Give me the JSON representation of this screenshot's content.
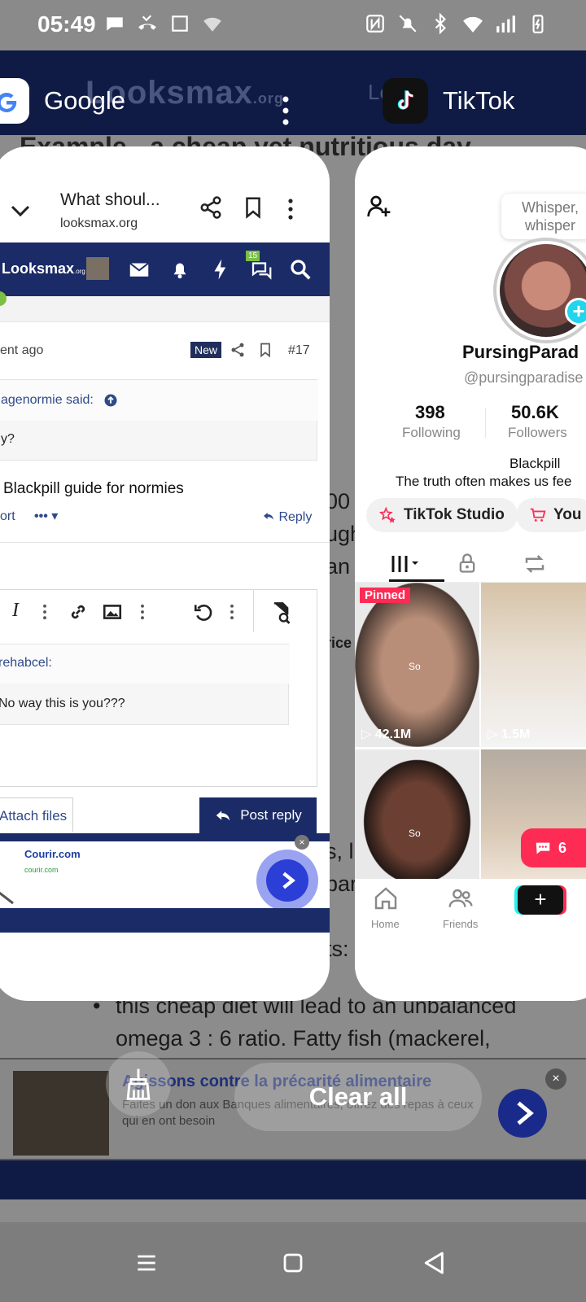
{
  "status_bar": {
    "time": "05:49",
    "icons_left": [
      "chat-icon",
      "missed-call-icon",
      "screen-icon",
      "wifi-calling-icon"
    ],
    "icons_right": [
      "nfc-icon",
      "mute-icon",
      "bluetooth-icon",
      "wifi-icon",
      "signal-icon",
      "battery-icon"
    ]
  },
  "background_page": {
    "site_logo": "Looksmax",
    "site_logo_suffix": ".org",
    "login_text": "Lo",
    "heading_text": "Example - a cheap yet nutritious day",
    "fragments": [
      "00",
      "ugh",
      "an :",
      "rice",
      "s, l",
      "bar",
      "ts:"
    ],
    "bullet_line_1": "this cheap diet will lead to an unbalanced",
    "bullet_line_2": "omega 3 : 6 ratio. Fatty fish (mackerel,",
    "ad_title": "Agissons contre la précarité alimentaire",
    "ad_desc": "Faites un don aux Banques alimentaires, offrez des repas à ceux qui en ont besoin",
    "ad_close": "×"
  },
  "recents": {
    "left_app": {
      "name": "Google",
      "menu_icon": "more-vert-icon"
    },
    "right_app": {
      "name": "TikTok"
    }
  },
  "browser_card": {
    "page_title": "What shoul...",
    "url": "looksmax.org",
    "nav_logo": "Looksmax",
    "nav_logo_suffix": ".org",
    "notif_badge": "15",
    "post_time": "ent ago",
    "badge_new": "New",
    "post_number": "#17",
    "quote_author": "agenormie said:",
    "quote_text": "y?",
    "post_text": "Blackpill guide for normies",
    "report_label": "ort",
    "more_label": "•••",
    "reply_label": "Reply",
    "editor_quote_author": "rehabcel:",
    "editor_quote_text": "No way this is you???",
    "attach_label": "Attach files",
    "post_reply_label": "Post reply",
    "ad_name": "Courir.com",
    "ad_url": "courir.com"
  },
  "tiktok_card": {
    "tooltip": "Whisper, whisper",
    "display_name": "PursingParad",
    "handle": "@pursingparadise",
    "following_count": "398",
    "following_label": "Following",
    "followers_count": "50.6K",
    "followers_label": "Followers",
    "bio_line_1": "Blackpill",
    "bio_line_2": "The truth often makes us fee",
    "chip_studio": "TikTok Studio",
    "chip_shop": "You",
    "pinned_label": "Pinned",
    "videos": [
      {
        "views": "42.1M",
        "caption": "So"
      },
      {
        "views": "1.5M",
        "caption": ""
      },
      {
        "views": "",
        "caption": "So"
      },
      {
        "views": "",
        "caption": ""
      }
    ],
    "comment_count": "6",
    "nav_home": "Home",
    "nav_friends": "Friends",
    "nav_create": "+"
  },
  "clear_all_label": "Clear all",
  "colors": {
    "looksmax_navy": "#1a2b67",
    "tiktok_red": "#fe2c55",
    "tiktok_cyan": "#25f4ee"
  }
}
